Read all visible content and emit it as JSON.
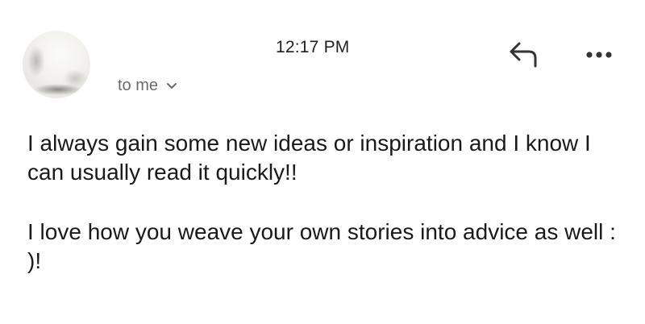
{
  "message": {
    "time": "12:17 PM",
    "recipient_label": "to me",
    "icons": {
      "avatar": "sender-avatar",
      "reply": "reply-icon",
      "more": "more-options-icon",
      "expand": "chevron-down-icon"
    },
    "body": {
      "paragraph_1": "I always gain some new ideas or inspiration and I know I can usually read it quickly!!",
      "paragraph_2": "I love how you weave your own stories into advice as well : )!"
    }
  }
}
